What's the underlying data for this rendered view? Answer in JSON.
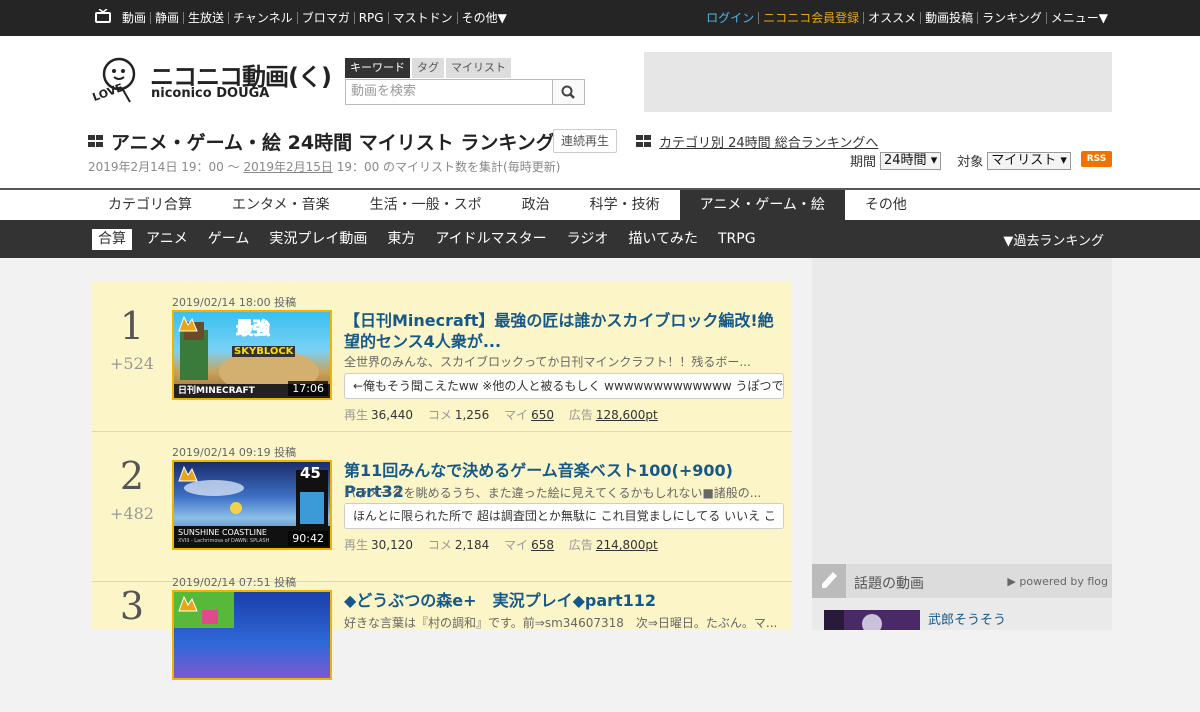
{
  "topbar": {
    "left": [
      "動画",
      "静画",
      "生放送",
      "チャンネル",
      "ブロマガ",
      "RPG",
      "マストドン",
      "その他▼"
    ],
    "login": "ログイン",
    "premium": "ニコニコ会員登録",
    "right": [
      "オススメ",
      "動画投稿",
      "ランキング",
      "メニュー▼"
    ]
  },
  "header": {
    "logo_main": "ニコニコ動画(く)",
    "logo_sub": "niconico DOUGA",
    "logo_love": "LOVE",
    "search_tabs": [
      "キーワード",
      "タグ",
      "マイリスト"
    ],
    "search_placeholder": "動画を検索",
    "page_title": "アニメ・ゲーム・絵 24時間 マイリスト ランキング",
    "continuous_play": "連続再生",
    "category_link": "カテゴリ別 24時間 総合ランキングへ",
    "period_start": "2019年2月14日 19：00 ～ ",
    "period_end_link": "2019年2月15日",
    "period_rest": " 19：00 のマイリスト数を集計(毎時更新)",
    "period_label": "期間",
    "period_value": "24時間",
    "target_label": "対象",
    "target_value": "マイリスト",
    "rss": "RSS"
  },
  "categories": [
    "カテゴリ合算",
    "エンタメ・音楽",
    "生活・一般・スポ",
    "政治",
    "科学・技術",
    "アニメ・ゲーム・絵",
    "その他"
  ],
  "active_category": "アニメ・ゲーム・絵",
  "subcategories": [
    "合算",
    "アニメ",
    "ゲーム",
    "実況プレイ動画",
    "東方",
    "アイドルマスター",
    "ラジオ",
    "描いてみた",
    "TRPG"
  ],
  "active_subcategory": "合算",
  "past_ranking": "▼過去ランキング",
  "labels": {
    "views": "再生",
    "comments": "コメ",
    "mylist": "マイ",
    "ads": "広告"
  },
  "items": [
    {
      "rank": "1",
      "change": "+524",
      "posted": "2019/02/14 18:00 投稿",
      "title": "【日刊Minecraft】最強の匠は誰かスカイブロック編改!絶望的センス4人衆が...",
      "description": "全世界のみんな、スカイブロックってか日刊マインクラフト！！残るボー...",
      "comment": "←俺もそう聞こえたww ※他の人と被るもしく wwwwwwwwwwwww うぽつで",
      "duration": "17:06",
      "views": "36,440",
      "comments": "1,256",
      "mylist": "650",
      "ads": "128,600pt",
      "thumb_text": "最強",
      "thumb_sub": "SKYBLOCK",
      "thumb_caption": "日刊MINECRAFT"
    },
    {
      "rank": "2",
      "change": "+482",
      "posted": "2019/02/14 09:19 投稿",
      "title": "第11回みんなで決めるゲーム音楽ベスト100(+900) Part32",
      "description": "パラメータを眺めるうち、また違った絵に見えてくるかもしれない■諸般の...",
      "comment": "ほんとに限られた所で 超は調査団とか無駄に これ目覚ましにしてる いいえ こ",
      "duration": "90:42",
      "views": "30,120",
      "comments": "2,184",
      "mylist": "658",
      "ads": "214,800pt",
      "thumb_text": "45",
      "thumb_sub": "SUNSHINE COASTLINE",
      "thumb_caption": "XVIII - Lachrimosa of DAWN: SPLASH"
    },
    {
      "rank": "3",
      "change": "",
      "posted": "2019/02/14 07:51 投稿",
      "title": "◆どうぶつの森e+　実況プレイ◆part112",
      "description": "好きな言葉は『村の調和』です。前⇒sm34607318　次⇒日曜日。たぶん。マ...",
      "comment": "",
      "duration": "",
      "views": "",
      "comments": "",
      "mylist": "",
      "ads": "",
      "thumb_text": "",
      "thumb_sub": "",
      "thumb_caption": ""
    }
  ],
  "sidebar": {
    "hot_title": "話題の動画",
    "powered": "▶ powered by flog",
    "first_video": "武郎そうそう"
  },
  "colors": {
    "topbar": "#252525",
    "link_blue": "#15598a",
    "login": "#4fb6e8",
    "premium": "#e8a617",
    "list_bg": "#fcf5c8",
    "rss": "#f27200"
  }
}
